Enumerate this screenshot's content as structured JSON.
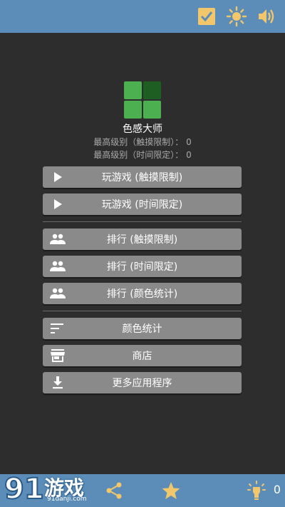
{
  "header": {
    "icons": [
      "checkbox-checked-icon",
      "brightness-icon",
      "volume-icon"
    ],
    "color": "#5b8db8"
  },
  "app": {
    "title": "色感大师",
    "logo_colors": [
      "#4caf50",
      "#1e5e22",
      "#4caf50",
      "#4caf50"
    ],
    "records": [
      {
        "label": "最高级别（触摸限制）： 0"
      },
      {
        "label": "最高级别（时间限定）： 0"
      }
    ]
  },
  "menu": {
    "play_touch": {
      "label": "玩游戏 (触摸限制)",
      "icon": "play-icon"
    },
    "play_time": {
      "label": "玩游戏 (时间限定)",
      "icon": "play-icon"
    },
    "rank_touch": {
      "label": "排行 (触摸限制)",
      "icon": "people-icon"
    },
    "rank_time": {
      "label": "排行 (时间限定)",
      "icon": "people-icon"
    },
    "rank_color": {
      "label": "排行 (颜色统计)",
      "icon": "people-icon"
    },
    "color_stats": {
      "label": "颜色统计",
      "icon": "sort-icon"
    },
    "store": {
      "label": "商店",
      "icon": "store-icon"
    },
    "more_apps": {
      "label": "更多应用程序",
      "icon": "download-icon"
    }
  },
  "footer": {
    "icons": [
      "share-icon",
      "star-icon",
      "lightbulb-icon"
    ],
    "coins": "0"
  },
  "watermark": {
    "logo": "91",
    "text": "游戏",
    "site": "91danji.com"
  }
}
